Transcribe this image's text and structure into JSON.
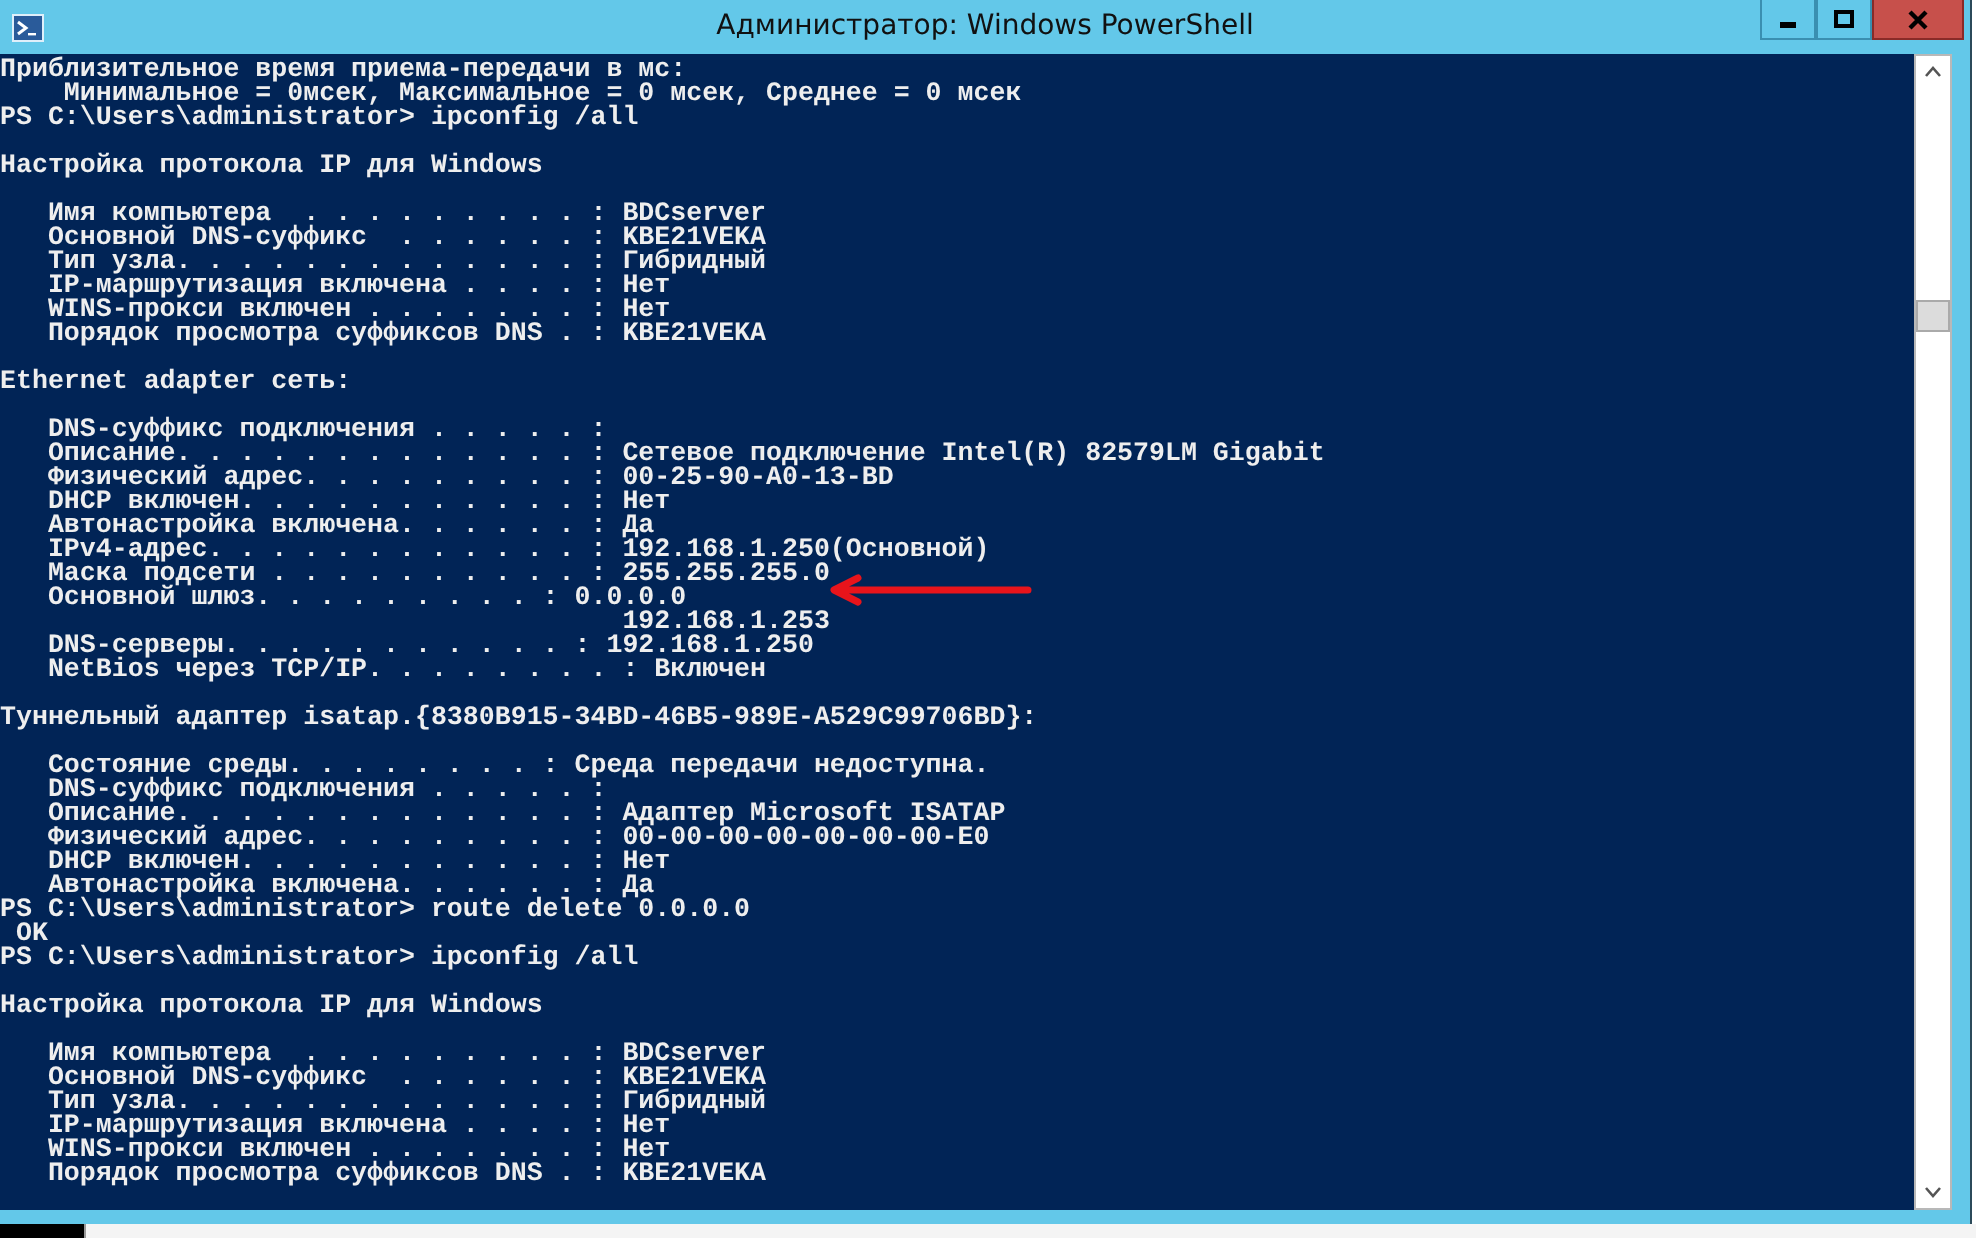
{
  "window": {
    "title": "Администратор: Windows PowerShell"
  },
  "console": {
    "blocks": [
      [
        "Приблизительное время приема-передачи в мс:",
        "    Минимальное = 0мсек, Максимальное = 0 мсек, Среднее = 0 мсек",
        "PS C:\\Users\\administrator> ipconfig /all"
      ],
      [
        "Настройка протокола IP для Windows"
      ],
      [
        "   Имя компьютера  . . . . . . . . . : BDCserver",
        "   Основной DNS-суффикс  . . . . . . : KBE21VEKA",
        "   Тип узла. . . . . . . . . . . . . : Гибридный",
        "   IP-маршрутизация включена . . . . : Нет",
        "   WINS-прокси включен . . . . . . . : Нет",
        "   Порядок просмотра суффиксов DNS . : KBE21VEKA"
      ],
      [
        "Ethernet adapter сеть:"
      ],
      [
        "   DNS-суффикс подключения . . . . . :",
        "   Описание. . . . . . . . . . . . . : Сетевое подключение Intel(R) 82579LM Gigabit",
        "   Физический адрес. . . . . . . . . : 00-25-90-A0-13-BD",
        "   DHCP включен. . . . . . . . . . . : Нет",
        "   Автонастройка включена. . . . . . : Да",
        "   IPv4-адрес. . . . . . . . . . . . : 192.168.1.250(Основной)",
        "   Маска подсети . . . . . . . . . . : 255.255.255.0",
        "   Основной шлюз. . . . . . . . . : 0.0.0.0",
        "                                       192.168.1.253",
        "   DNS-серверы. . . . . . . . . . . : 192.168.1.250",
        "   NetBios через TCP/IP. . . . . . . . : Включен"
      ],
      [
        "Туннельный адаптер isatap.{8380B915-34BD-46B5-989E-A529C99706BD}:"
      ],
      [
        "   Состояние среды. . . . . . . . : Среда передачи недоступна.",
        "   DNS-суффикс подключения . . . . . :",
        "   Описание. . . . . . . . . . . . . : Адаптер Microsoft ISATAP",
        "   Физический адрес. . . . . . . . . : 00-00-00-00-00-00-00-E0",
        "   DHCP включен. . . . . . . . . . . : Нет",
        "   Автонастройка включена. . . . . . : Да",
        "PS C:\\Users\\administrator> route delete 0.0.0.0",
        " OK",
        "PS C:\\Users\\administrator> ipconfig /all"
      ],
      [
        "Настройка протокола IP для Windows"
      ],
      [
        "   Имя компьютера  . . . . . . . . . : BDCserver",
        "   Основной DNS-суффикс  . . . . . . : KBE21VEKA",
        "   Тип узла. . . . . . . . . . . . . : Гибридный",
        "   IP-маршрутизация включена . . . . : Нет",
        "   WINS-прокси включен . . . . . . . : Нет",
        "   Порядок просмотра суффиксов DNS . : KBE21VEKA"
      ]
    ]
  }
}
